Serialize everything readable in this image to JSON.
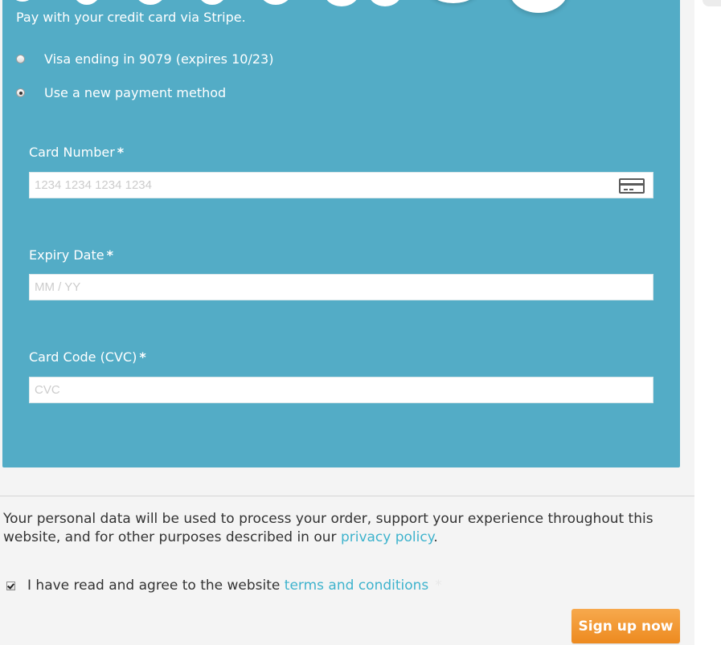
{
  "payment": {
    "description": "Pay with your credit card via Stripe.",
    "saved_method_label": "Visa ending in 9079 (expires 10/23)",
    "new_method_label": "Use a new payment method",
    "selected": "new",
    "fields": {
      "card_number": {
        "label": "Card Number",
        "placeholder": "1234 1234 1234 1234",
        "required_mark": "*",
        "icon": "credit-card-icon"
      },
      "expiry": {
        "label": "Expiry Date",
        "placeholder": "MM / YY",
        "required_mark": "*"
      },
      "cvc": {
        "label": "Card Code (CVC)",
        "placeholder": "CVC",
        "required_mark": "*"
      }
    }
  },
  "privacy": {
    "text_before": "Your personal data will be used to process your order, support your experience throughout this website, and for other purposes described in our ",
    "link_text": "privacy policy",
    "text_after": "."
  },
  "terms": {
    "checked": true,
    "text_before": "I have read and agree to the website ",
    "link_text": "terms and conditions",
    "required_mark": "*"
  },
  "signup_button": {
    "label": "Sign up now"
  },
  "colors": {
    "payment_box_bg": "#53acc6",
    "link": "#3eb3cd",
    "button": "#f19a35",
    "page_bg": "#f4f4f4"
  }
}
